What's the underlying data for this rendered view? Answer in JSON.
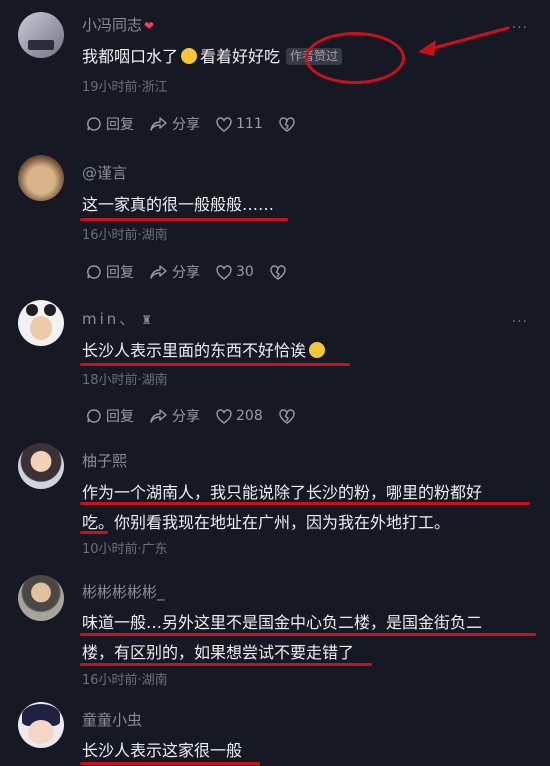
{
  "comments": [
    {
      "username": "小冯同志",
      "text": "我都咽口水了",
      "text_after": "看着好好吃",
      "badge": "作者赞过",
      "meta": "19小时前·浙江",
      "reply": "回复",
      "share": "分享",
      "likes": "111",
      "icons": [
        "emoji-heart-icon",
        "drool-emoji-icon"
      ]
    },
    {
      "username": "@谨言",
      "text": "这一家真的很一般般般……",
      "meta": "16小时前·湖南",
      "reply": "回复",
      "share": "分享",
      "likes": "30"
    },
    {
      "username": "min、",
      "text": "长沙人表示里面的东西不好恰诶",
      "meta": "18小时前·湖南",
      "reply": "回复",
      "share": "分享",
      "likes": "208",
      "icons": [
        "laughing-emoji-icon"
      ]
    },
    {
      "username": "柚子熙",
      "text_line1": "作为一个湖南人，我只能说除了长沙的粉，哪里的粉都好",
      "text_line2": "吃。你别看我现在地址在广州，因为我在外地打工。",
      "meta": "10小时前·广东"
    },
    {
      "username": "彬彬彬彬彬_",
      "text_line1": "味道一般…另外这里不是国金中心负二楼，是国金街负二",
      "text_line2": "楼，有区别的，如果想尝试不要走错了",
      "meta": "16小时前·湖南"
    },
    {
      "username": "童童小虫",
      "text": "长沙人表示这家很一般"
    }
  ],
  "colors": {
    "background": "#161823",
    "annotation_red": "#c8101f",
    "username": "#8a8b93",
    "text": "#eeeef2"
  }
}
